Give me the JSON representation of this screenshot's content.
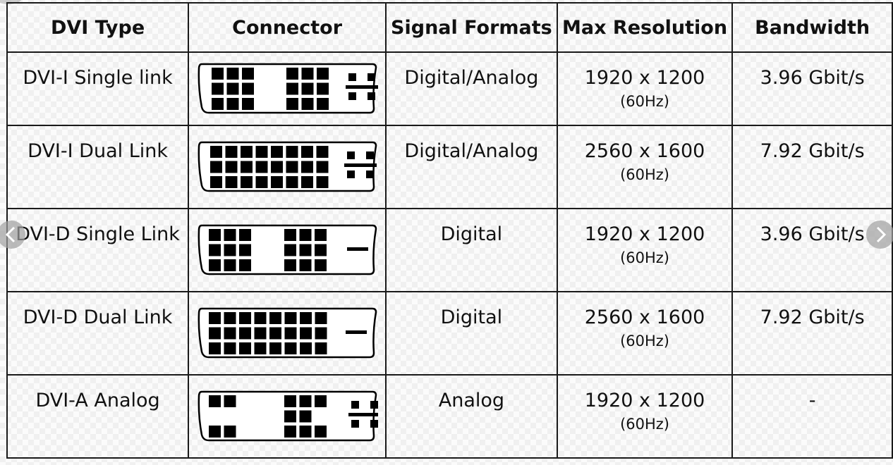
{
  "table": {
    "headers": [
      "DVI Type",
      "Connector",
      "Signal Formats",
      "Max Resolution",
      "Bandwidth"
    ],
    "rows": [
      {
        "type": "DVI-I Single link",
        "connector_icon": "dvi-i-single-link-connector-icon",
        "signal": "Digital/Analog",
        "resolution": "1920 x 1200",
        "refresh": "(60Hz)",
        "bandwidth": "3.96 Gbit/s"
      },
      {
        "type": "DVI-I Dual Link",
        "connector_icon": "dvi-i-dual-link-connector-icon",
        "signal": "Digital/Analog",
        "resolution": "2560 x 1600",
        "refresh": "(60Hz)",
        "bandwidth": "7.92 Gbit/s"
      },
      {
        "type": "DVI-D Single Link",
        "connector_icon": "dvi-d-single-link-connector-icon",
        "signal": "Digital",
        "resolution": "1920 x 1200",
        "refresh": "(60Hz)",
        "bandwidth": "3.96 Gbit/s"
      },
      {
        "type": "DVI-D Dual Link",
        "connector_icon": "dvi-d-dual-link-connector-icon",
        "signal": "Digital",
        "resolution": "2560 x 1600",
        "refresh": "(60Hz)",
        "bandwidth": "7.92 Gbit/s"
      },
      {
        "type": "DVI-A Analog",
        "connector_icon": "dvi-a-analog-connector-icon",
        "signal": "Analog",
        "resolution": "1920 x 1200",
        "refresh": "(60Hz)",
        "bandwidth": "-"
      }
    ]
  },
  "navigation": {
    "prev_icon": "chevron-left-icon",
    "next_icon": "chevron-right-icon"
  },
  "colors": {
    "grid": "#1a1a1a",
    "nav_button": "#a0a0a0"
  }
}
